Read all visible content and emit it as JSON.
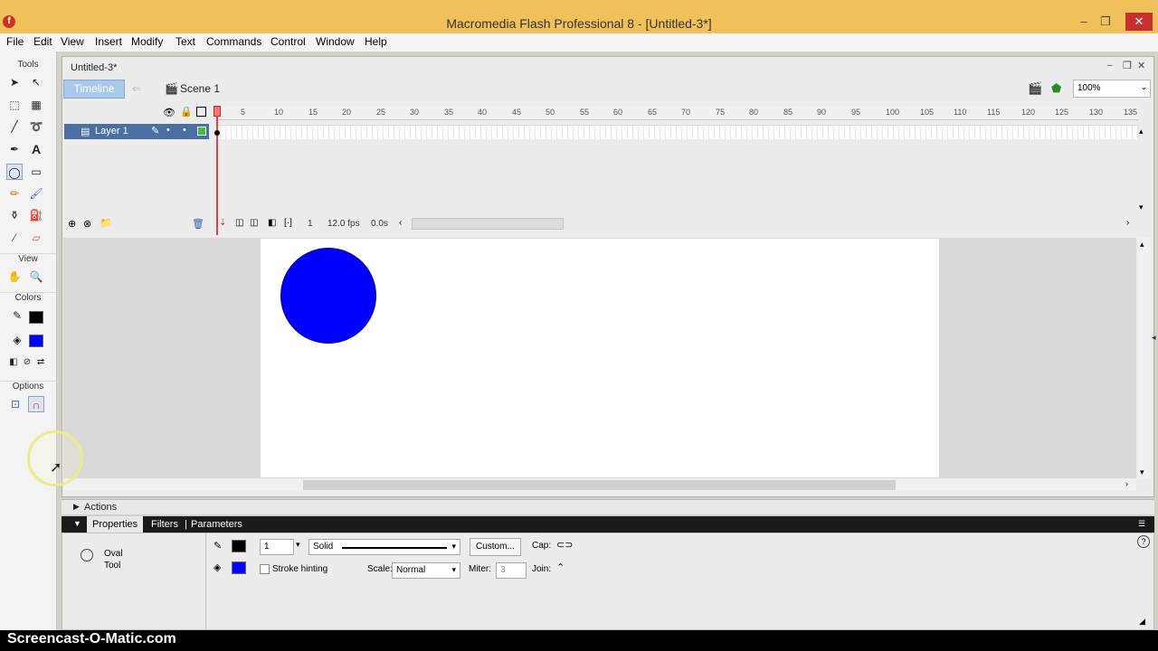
{
  "window": {
    "title": "Macromedia Flash Professional 8 - [Untitled-3*]"
  },
  "menu": [
    "File",
    "Edit",
    "View",
    "Insert",
    "Modify",
    "Text",
    "Commands",
    "Control",
    "Window",
    "Help"
  ],
  "toolbox": {
    "tools_label": "Tools",
    "view_label": "View",
    "colors_label": "Colors",
    "options_label": "Options"
  },
  "document": {
    "tab": "Untitled-3*",
    "timeline_label": "Timeline",
    "scene_label": "Scene 1",
    "zoom": "100%"
  },
  "timeline": {
    "ruler_ticks": [
      "5",
      "10",
      "15",
      "20",
      "25",
      "30",
      "35",
      "40",
      "45",
      "50",
      "55",
      "60",
      "65",
      "70",
      "75",
      "80",
      "85",
      "90",
      "95",
      "100",
      "105",
      "110",
      "115",
      "120",
      "125",
      "130",
      "135"
    ],
    "layer_name": "Layer 1",
    "current_frame": "1",
    "fps": "12.0 fps",
    "time": "0.0s"
  },
  "panels": {
    "actions": "Actions",
    "tabs": [
      "Properties",
      "Filters",
      "Parameters"
    ]
  },
  "properties": {
    "tool_name_line1": "Oval",
    "tool_name_line2": "Tool",
    "stroke_height": "1",
    "stroke_style": "Solid",
    "custom_button": "Custom...",
    "cap_label": "Cap:",
    "stroke_hinting_label": "Stroke hinting",
    "scale_label": "Scale:",
    "scale_value": "Normal",
    "miter_label": "Miter:",
    "miter_value": "3",
    "join_label": "Join:"
  },
  "colors": {
    "stroke": "#000000",
    "fill": "#0000ff",
    "title_bar": "#f0c05a"
  },
  "watermark": "Screencast-O-Matic.com"
}
